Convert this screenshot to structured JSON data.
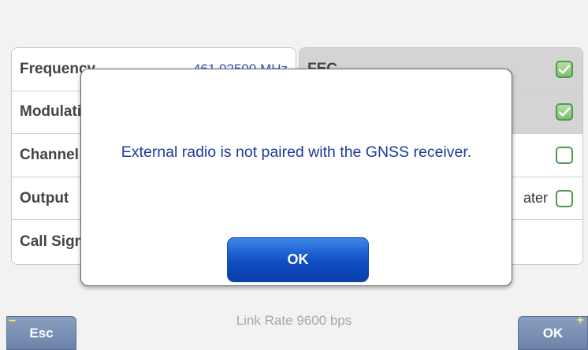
{
  "left_panel": {
    "rows": [
      {
        "label": "Frequency",
        "value": "461.02500 MHz"
      },
      {
        "label": "Modulation",
        "value": ""
      },
      {
        "label": "Channel",
        "value": ""
      },
      {
        "label": "Output",
        "value": ""
      },
      {
        "label": "Call Sign",
        "value": ""
      }
    ]
  },
  "right_panel": {
    "rows": [
      {
        "label": "FEC",
        "checked": true
      },
      {
        "label": "",
        "checked": true
      },
      {
        "label": "",
        "checked": false
      },
      {
        "label": "ater",
        "checked": false
      },
      {
        "label": "",
        "checked": null
      }
    ]
  },
  "dialog": {
    "message": "External radio is not paired with the GNSS receiver.",
    "ok_label": "OK"
  },
  "status": {
    "text": "Link Rate 9600 bps"
  },
  "footer": {
    "esc_label": "Esc",
    "esc_mark": "−",
    "ok_label": "OK",
    "ok_mark": "+"
  },
  "colors": {
    "accent_blue": "#0f4cc4",
    "value_blue": "#3a4fb0",
    "checkbox_green": "#4f9a4f"
  }
}
